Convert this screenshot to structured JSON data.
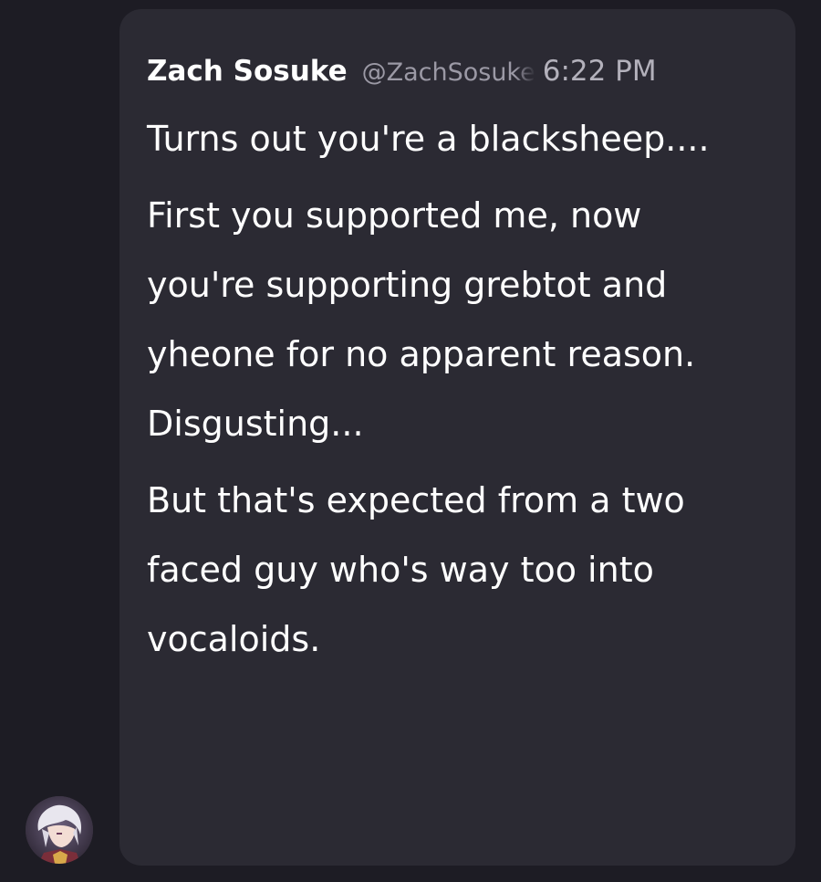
{
  "message": {
    "author_name": "Zach Sosuke",
    "author_handle": "@ZachSosuke",
    "timestamp": "6:22 PM",
    "paragraphs": [
      "Turns out you're a blacksheep....",
      "First you supported me, now you're supporting grebtot and yheone for no apparent reason. Disgusting...",
      "But that's expected from a two faced guy who's way too into vocaloids."
    ]
  },
  "colors": {
    "background": "#1d1c24",
    "bubble": "#2b2a33",
    "text": "#ffffff",
    "handle": "#9b99a5"
  },
  "icons": {
    "avatar": "avatar-icon"
  }
}
